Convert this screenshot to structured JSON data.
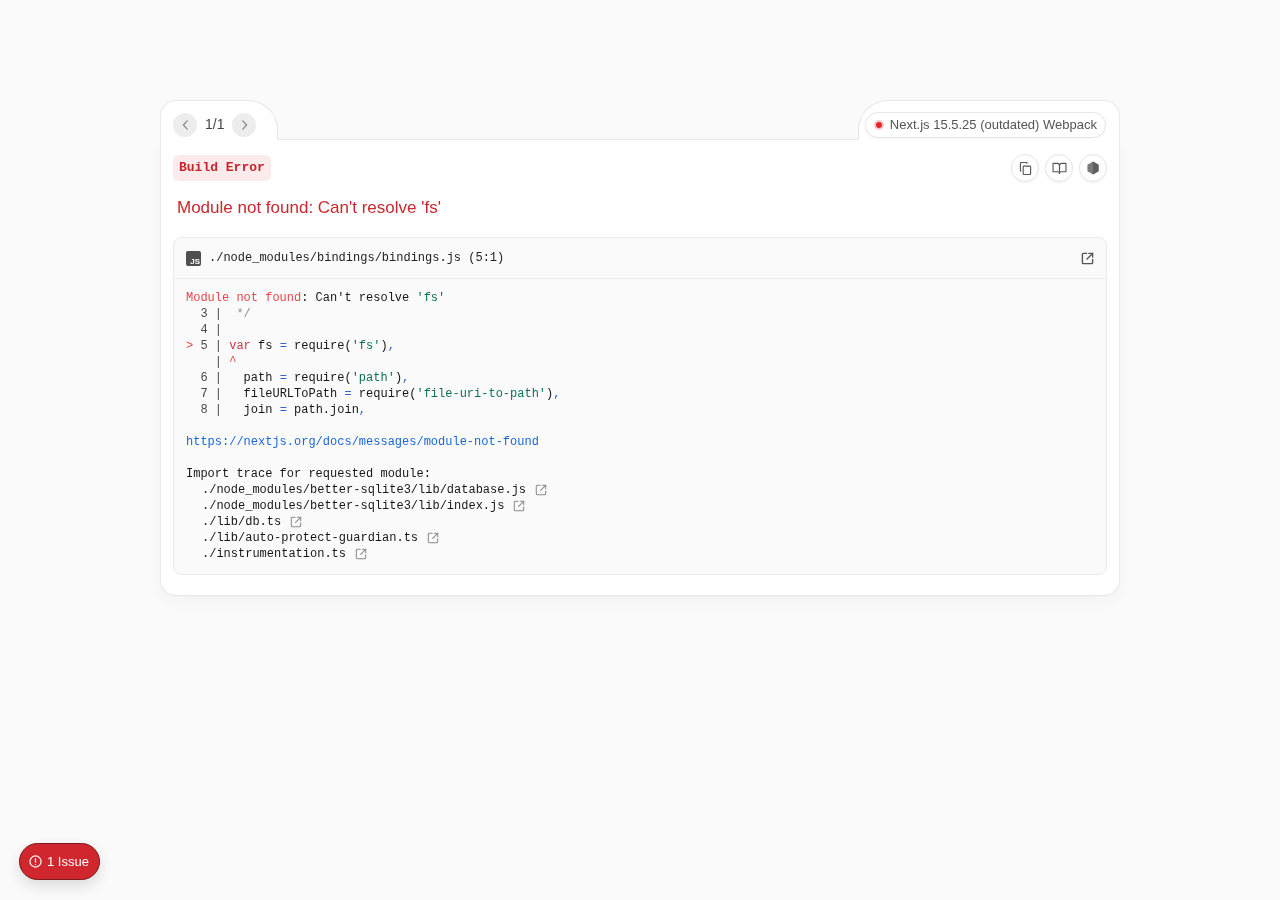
{
  "pagination": {
    "counter": "1/1"
  },
  "version_badge": {
    "label": "Next.js 15.5.25 (outdated) Webpack"
  },
  "error_type": "Build Error",
  "message": "Module not found: Can't resolve 'fs'",
  "code_frame": {
    "file_icon_label": "JS",
    "file": "./node_modules/bindings/bindings.js (5:1)",
    "lines": [
      {
        "tokens": [
          {
            "text": "Module not found",
            "kind": "error"
          },
          {
            "text": ": Can't resolve ",
            "kind": "plain"
          },
          {
            "text": "'fs'",
            "kind": "string"
          }
        ]
      },
      {
        "tokens": [
          {
            "text": "  3 | ",
            "kind": "gutter"
          },
          {
            "text": " */",
            "kind": "comment"
          }
        ]
      },
      {
        "tokens": [
          {
            "text": "  4 |",
            "kind": "gutter"
          }
        ]
      },
      {
        "tokens": [
          {
            "text": ">",
            "kind": "marker"
          },
          {
            "text": " 5 | ",
            "kind": "gutter"
          },
          {
            "text": "var",
            "kind": "keyword"
          },
          {
            "text": " fs ",
            "kind": "plain"
          },
          {
            "text": "=",
            "kind": "punct"
          },
          {
            "text": " require(",
            "kind": "plain"
          },
          {
            "text": "'fs'",
            "kind": "string"
          },
          {
            "text": ")",
            "kind": "plain"
          },
          {
            "text": ",",
            "kind": "punct"
          }
        ]
      },
      {
        "tokens": [
          {
            "text": "    | ",
            "kind": "gutter"
          },
          {
            "text": "^",
            "kind": "marker"
          }
        ]
      },
      {
        "tokens": [
          {
            "text": "  6 | ",
            "kind": "gutter"
          },
          {
            "text": "  path ",
            "kind": "plain"
          },
          {
            "text": "=",
            "kind": "punct"
          },
          {
            "text": " require(",
            "kind": "plain"
          },
          {
            "text": "'path'",
            "kind": "string"
          },
          {
            "text": ")",
            "kind": "plain"
          },
          {
            "text": ",",
            "kind": "punct"
          }
        ]
      },
      {
        "tokens": [
          {
            "text": "  7 | ",
            "kind": "gutter"
          },
          {
            "text": "  fileURLToPath ",
            "kind": "plain"
          },
          {
            "text": "=",
            "kind": "punct"
          },
          {
            "text": " require(",
            "kind": "plain"
          },
          {
            "text": "'file-uri-to-path'",
            "kind": "string"
          },
          {
            "text": ")",
            "kind": "plain"
          },
          {
            "text": ",",
            "kind": "punct"
          }
        ]
      },
      {
        "tokens": [
          {
            "text": "  8 | ",
            "kind": "gutter"
          },
          {
            "text": "  join ",
            "kind": "plain"
          },
          {
            "text": "=",
            "kind": "punct"
          },
          {
            "text": " path.join",
            "kind": "plain"
          },
          {
            "text": ",",
            "kind": "punct"
          }
        ]
      }
    ],
    "docs_link": "https://nextjs.org/docs/messages/module-not-found",
    "trace_title": "Import trace for requested module:",
    "trace": [
      "./node_modules/better-sqlite3/lib/database.js",
      "./node_modules/better-sqlite3/lib/index.js",
      "./lib/db.ts",
      "./lib/auto-protect-guardian.ts",
      "./instrumentation.ts"
    ]
  },
  "issues_button": {
    "label": "1 Issue"
  }
}
